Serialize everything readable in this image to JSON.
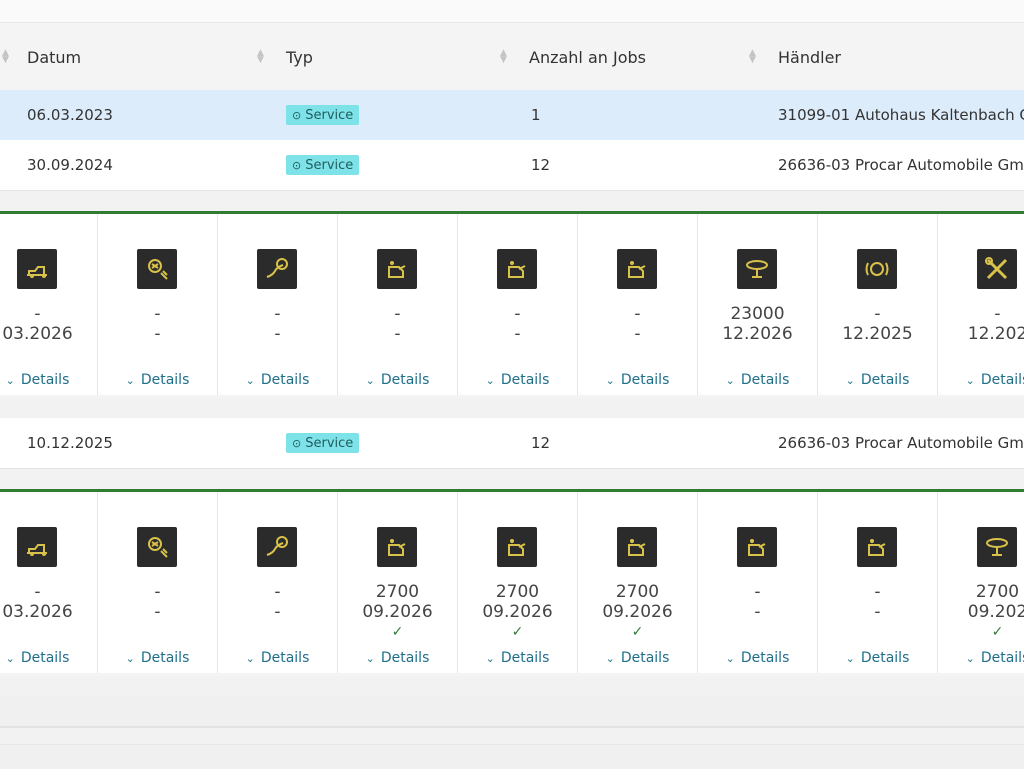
{
  "table": {
    "columns": [
      {
        "label": "Datum"
      },
      {
        "label": "Typ"
      },
      {
        "label": "Anzahl an Jobs"
      },
      {
        "label": "Händler"
      }
    ],
    "rows": [
      {
        "date": "06.03.2023",
        "type": "Service",
        "jobs": "1",
        "dealer": "31099-01 Autohaus Kaltenbach G"
      },
      {
        "date": "30.09.2024",
        "type": "Service",
        "jobs": "12",
        "dealer": "26636-03 Procar Automobile Gm"
      },
      {
        "date": "10.12.2025",
        "type": "Service",
        "jobs": "12",
        "dealer": "26636-03 Procar Automobile Gm"
      }
    ]
  },
  "details_label": "Details",
  "panels": [
    {
      "cards": [
        {
          "icon": "car-lift-icon",
          "line1": "-",
          "line2": "03.2026",
          "done": false
        },
        {
          "icon": "brake-fluid-icon",
          "line1": "-",
          "line2": "-",
          "done": false
        },
        {
          "icon": "brake-hose-icon",
          "line1": "-",
          "line2": "-",
          "done": false
        },
        {
          "icon": "oil-can-icon",
          "line1": "-",
          "line2": "-",
          "done": false
        },
        {
          "icon": "oil-can-icon",
          "line1": "-",
          "line2": "-",
          "done": false
        },
        {
          "icon": "oil-can-icon",
          "line1": "-",
          "line2": "-",
          "done": false
        },
        {
          "icon": "air-filter-icon",
          "line1": "23000",
          "line2": "12.2026",
          "done": false
        },
        {
          "icon": "brake-warning-icon",
          "line1": "-",
          "line2": "12.2025",
          "done": false
        },
        {
          "icon": "tools-icon",
          "line1": "-",
          "line2": "12.202",
          "done": false
        }
      ]
    },
    {
      "cards": [
        {
          "icon": "car-lift-icon",
          "line1": "-",
          "line2": "03.2026",
          "done": false
        },
        {
          "icon": "brake-fluid-icon",
          "line1": "-",
          "line2": "-",
          "done": false
        },
        {
          "icon": "brake-hose-icon",
          "line1": "-",
          "line2": "-",
          "done": false
        },
        {
          "icon": "oil-can-icon",
          "line1": "2700",
          "line2": "09.2026",
          "done": true
        },
        {
          "icon": "oil-can-icon",
          "line1": "2700",
          "line2": "09.2026",
          "done": true
        },
        {
          "icon": "oil-can-icon",
          "line1": "2700",
          "line2": "09.2026",
          "done": true
        },
        {
          "icon": "oil-can-icon",
          "line1": "-",
          "line2": "-",
          "done": false
        },
        {
          "icon": "oil-can-icon",
          "line1": "-",
          "line2": "-",
          "done": false
        },
        {
          "icon": "air-filter-icon",
          "line1": "2700",
          "line2": "09.202",
          "done": true
        }
      ]
    }
  ],
  "check_symbol": "✓",
  "colors": {
    "accent_green": "#2e7d32",
    "badge_bg": "#7ee3e8",
    "selected_row": "#ddecfb",
    "link": "#1f6f8b"
  }
}
